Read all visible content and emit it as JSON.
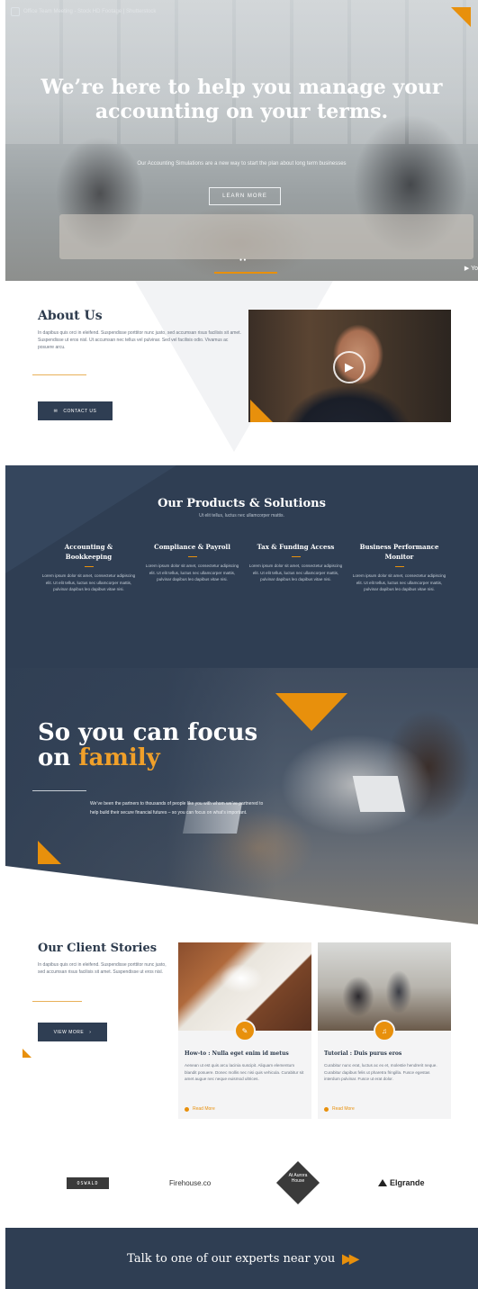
{
  "hero": {
    "topbar_text": "Office Team Meeting - Stock HD Footage | Shutterstock",
    "title": "We’re here to help you manage your accounting on your terms.",
    "subtitle": "Our Accounting Simulations are a new way to start the plan about long term businesses",
    "button": "LEARN MORE",
    "youtube_label": "Yo"
  },
  "about": {
    "title": "About Us",
    "text": "In dapibus quis orci in eleifend. Suspendisse porttitor nunc justo, sed accumsan risus facilisis sit amet. Suspendisse ut eros nisl. Ut accumsan nec tellus vel pulvinar. Sed vel facilisis odio. Vivamus ac posuere arcu.",
    "button": "CONTACT US"
  },
  "products": {
    "title": "Our Products & Solutions",
    "subtitle": "Ut elit tellus, luctus nec ullamcorper mattis.",
    "items": [
      {
        "title": "Accounting & Bookkeeping",
        "text": "Lorem ipsum dolor sit amet, consectetur adipiscing elit. Ut elit tellus, luctus nec ullamcorper mattis, pulvinar dapibus leo dapibus vitae nisi."
      },
      {
        "title": "Compliance & Payroll",
        "text": "Lorem ipsum dolor sit amet, consectetur adipiscing elit. Ut elit tellus, luctus nec ullamcorper mattis, pulvinar dapibus leo dapibus vitae nisi."
      },
      {
        "title": "Tax & Funding Access",
        "text": "Lorem ipsum dolor sit amet, consectetur adipiscing elit. Ut elit tellus, luctus nec ullamcorper mattis, pulvinar dapibus leo dapibus vitae nisi."
      },
      {
        "title": "Business Performance Monitor",
        "text": "Lorem ipsum dolor sit amet, consectetur adipiscing elit. Ut elit tellus, luctus nec ullamcorper mattis, pulvinar dapibus leo dapibus vitae nisi."
      }
    ]
  },
  "family": {
    "title_line1": "So you can focus",
    "title_on": "on",
    "title_accent": "family",
    "text": "We’ve been the partners to thousands of people like you with whom we’ve partnered to help build their secure financial futures – so you can focus on what’s important."
  },
  "stories": {
    "title": "Our Client Stories",
    "text": "In dapibus quis orci in eleifend. Suspendisse porttitor nunc justo, sed accumsan risus facilisis sit amet. Suspendisse ut eros nisl.",
    "button": "VIEW MORE",
    "cards": [
      {
        "title": "How-to : Nulla eget enim id metus",
        "text": "Aenean ut est quis arcu lacinia suscipit. Aliquam elementum blandit posuere. Donec mollis nec nisi quis vehicula. Curabitur sit amet augue nec neque euismod ultrices.",
        "link": "Read More"
      },
      {
        "title": "Tutorial : Duis purus eros",
        "text": "Curabitur nunc erat, luctus ac ex et, molestie hendrerit neque. Curabitur dapibus felis ut pharetra fringilla. Fusce egestas interdum pulvinar. Fusce ut erat dolor.",
        "link": "Read More"
      }
    ]
  },
  "logos": {
    "oswald": "OSWALD",
    "firehouse": "Firehouse.co",
    "aurora": "At Aurora House",
    "elgrande": "Elgrande"
  },
  "cta": {
    "text": "Talk to one of our experts near you",
    "arrow": "▶▶"
  },
  "colors": {
    "navy": "#2f3e53",
    "accent": "#e8900c"
  }
}
